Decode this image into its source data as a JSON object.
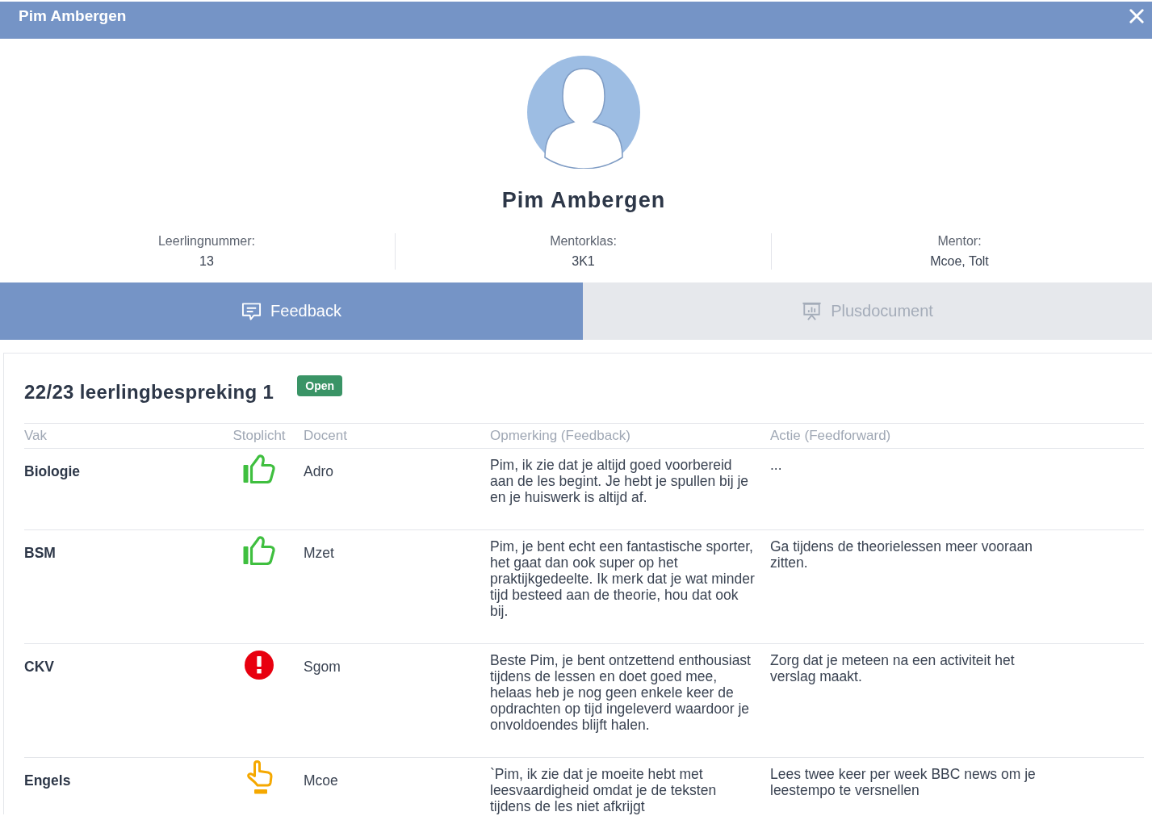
{
  "window": {
    "title": "Pim Ambergen"
  },
  "profile": {
    "name": "Pim Ambergen",
    "fields": [
      {
        "label": "Leerlingnummer:",
        "value": "13"
      },
      {
        "label": "Mentorklas:",
        "value": "3K1"
      },
      {
        "label": "Mentor:",
        "value": "Mcoe, Tolt"
      }
    ]
  },
  "tabs": [
    {
      "label": "Feedback",
      "selected": true
    },
    {
      "label": "Plusdocument",
      "selected": false
    }
  ],
  "meeting": {
    "title": "22/23 leerlingbespreking 1",
    "status": "Open",
    "table": {
      "columns": [
        "Vak",
        "Stoplicht",
        "Docent",
        "Opmerking (Feedback)",
        "Actie (Feedforward)"
      ],
      "rows": [
        {
          "subject": "Biologie",
          "kind": "thumbs",
          "color": "#3fbf3f",
          "teacher": "Adro",
          "feedback": "Pim, ik zie dat je altijd goed voorbereid aan de les begint. Je hebt je spullen bij je en je huiswerk is altijd af.",
          "action": "..."
        },
        {
          "subject": "BSM",
          "kind": "thumbs",
          "color": "#3fbf3f",
          "teacher": "Mzet",
          "feedback": "Pim, je bent echt een fantastische sporter, het gaat dan ook super op het praktijkgedeelte. Ik merk dat je wat minder tijd besteed aan de theorie, hou dat ook bij.",
          "action": "Ga tijdens de theorielessen meer vooraan zitten."
        },
        {
          "subject": "CKV",
          "kind": "alert",
          "color": "#e8000f",
          "teacher": "Sgom",
          "feedback": "Beste Pim, je bent ontzettend enthousiast tijdens de lessen en doet goed mee, helaas heb je nog geen enkele keer de opdrachten op tijd ingeleverd waardoor je onvoldoendes blijft halen.",
          "action": "Zorg dat je meteen na een activiteit het verslag maakt."
        },
        {
          "subject": "Engels",
          "kind": "pointer",
          "color": "#f5a800",
          "teacher": "Mcoe",
          "feedback": "`Pim, ik zie dat je moeite hebt met leesvaardigheid omdat je de teksten tijdens de les niet afkrijgt",
          "action": "Lees twee keer per week BBC news om je leestempo te versnellen"
        }
      ]
    }
  }
}
